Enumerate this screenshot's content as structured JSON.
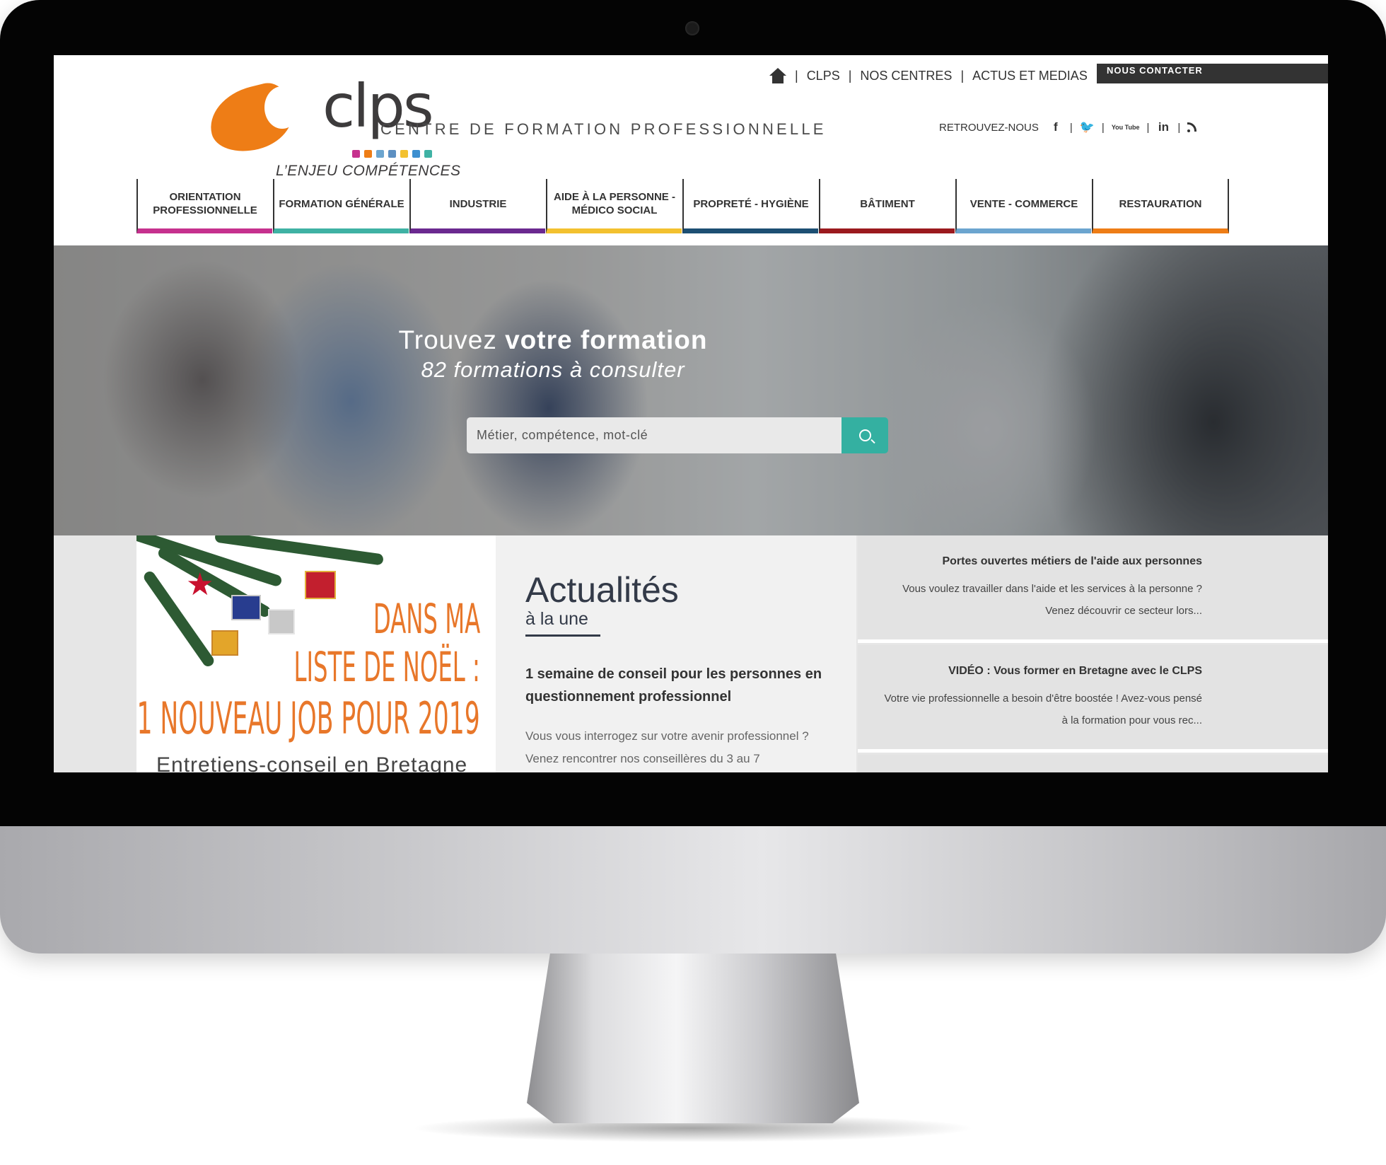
{
  "header": {
    "logo_word": "clps",
    "logo_tagline": "L’ENJEU COMPÉTENCES",
    "site_subtitle": "CENTRE DE FORMATION PROFESSIONNELLE",
    "logo_dot_colors": [
      "#c6318e",
      "#ee7d16",
      "#6ca5cf",
      "#5c8fc1",
      "#f3c12f",
      "#3d8fd0",
      "#3fb2a4"
    ],
    "logo_color": "#ee7d16"
  },
  "top_nav": {
    "home_icon": "home-icon",
    "items": [
      "CLPS",
      "NOS CENTRES",
      "ACTUS ET MEDIAS"
    ],
    "contact": "NOUS CONTACTER"
  },
  "social": {
    "label": "RETROUVEZ-NOUS",
    "facebook": "f",
    "twitter": "🐦",
    "youtube": "You Tube",
    "linkedin": "in",
    "icons": [
      "facebook-icon",
      "twitter-icon",
      "youtube-icon",
      "linkedin-icon",
      "rss-icon"
    ]
  },
  "main_menu": [
    {
      "label": "ORIENTATION PROFESSIONNELLE",
      "color": "#c6318e"
    },
    {
      "label": "FORMATION GÉNÉRALE",
      "color": "#3fb2a4"
    },
    {
      "label": "INDUSTRIE",
      "color": "#6b2990"
    },
    {
      "label": "AIDE À LA PERSONNE - MÉDICO SOCIAL",
      "color": "#f3c12f"
    },
    {
      "label": "PROPRETÉ - HYGIÈNE",
      "color": "#1d4f73"
    },
    {
      "label": "BÂTIMENT",
      "color": "#9b1a1e"
    },
    {
      "label": "VENTE - COMMERCE",
      "color": "#6ca5cf"
    },
    {
      "label": "RESTAURATION",
      "color": "#ee7d16"
    }
  ],
  "hero": {
    "title_prefix": "Trouvez ",
    "title_bold": "votre formation",
    "count_text": "82 formations à consulter",
    "search_placeholder": "Métier, compétence, mot-clé",
    "search_button_color": "#34b0a1"
  },
  "promo": {
    "line1": "DANS MA",
    "line2": "LISTE DE NOËL :",
    "line3": "1 NOUVEAU JOB POUR 2019",
    "footer": "Entretiens-conseil en Bretagne"
  },
  "news": {
    "heading": "Actualités",
    "subheading": "à la une",
    "title": "1 semaine de conseil pour les personnes en questionnement professionnel",
    "excerpt": "Vous vous interrogez sur votre avenir professionnel ? Venez rencontrer nos conseillères du 3 au 7"
  },
  "side_news": [
    {
      "title": "Portes ouvertes métiers de l'aide aux personnes",
      "text": "Vous voulez travailler dans l'aide et les services à la personne ? Venez découvrir ce secteur lors..."
    },
    {
      "title": "VIDÉO : Vous former en Bretagne avec le CLPS",
      "text": "Votre vie professionnelle a besoin d'être boostée ! Avez-vous pensé à la formation pour vous rec..."
    }
  ]
}
